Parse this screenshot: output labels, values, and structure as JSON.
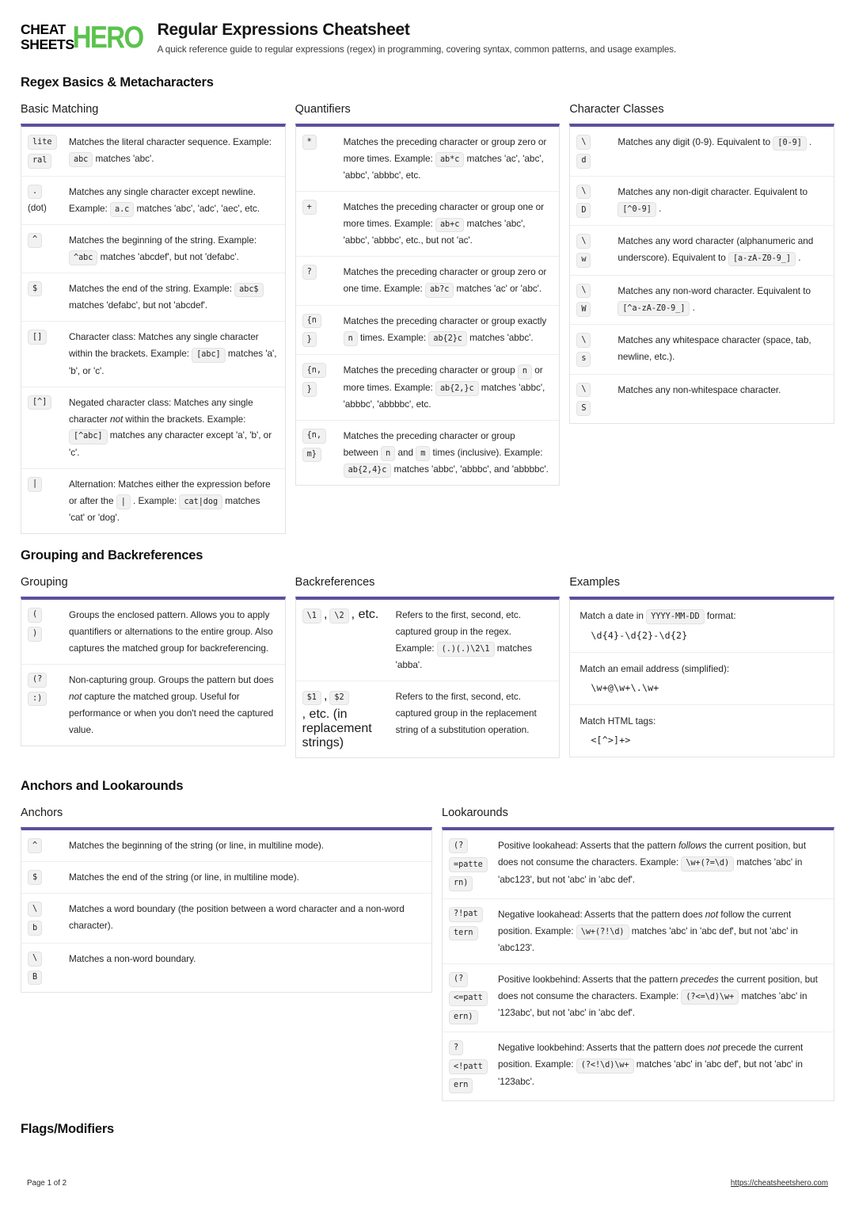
{
  "brand": {
    "line1": "CHEAT",
    "line2": "SHEETS",
    "hero": "HERO",
    "green": "#5cc24f"
  },
  "header": {
    "title": "Regular Expressions Cheatsheet",
    "subtitle": "A quick reference guide to regular expressions (regex) in programming, covering syntax, common patterns, and usage examples."
  },
  "accent": "#5d4f9e",
  "sections": [
    {
      "id": "basics",
      "title": "Regex Basics & Metacharacters"
    },
    {
      "id": "grouping",
      "title": "Grouping and Backreferences"
    },
    {
      "id": "anchors",
      "title": "Anchors and Lookarounds"
    },
    {
      "id": "flags",
      "title": "Flags/Modifiers"
    }
  ],
  "cards": {
    "basic_matching": {
      "title": "Basic Matching",
      "rows": [
        {
          "keys": [
            "lite",
            "ral"
          ],
          "desc": [
            {
              "t": "text",
              "v": "Matches the literal character sequence. Example: "
            },
            {
              "t": "chip",
              "v": "abc"
            },
            {
              "t": "text",
              "v": " matches 'abc'."
            }
          ]
        },
        {
          "keys": [
            "."
          ],
          "keys_plain": [
            "(dot)"
          ],
          "desc": [
            {
              "t": "text",
              "v": "Matches any single character except newline. Example: "
            },
            {
              "t": "chip",
              "v": "a.c"
            },
            {
              "t": "text",
              "v": " matches 'abc', 'adc', 'aec', etc."
            }
          ]
        },
        {
          "keys": [
            "^"
          ],
          "desc": [
            {
              "t": "text",
              "v": "Matches the beginning of the string. Example: "
            },
            {
              "t": "chip",
              "v": "^abc"
            },
            {
              "t": "text",
              "v": " matches 'abcdef', but not 'defabc'."
            }
          ]
        },
        {
          "keys": [
            "$"
          ],
          "desc": [
            {
              "t": "text",
              "v": "Matches the end of the string. Example: "
            },
            {
              "t": "chip",
              "v": "abc$"
            },
            {
              "t": "text",
              "v": " matches 'defabc', but not 'abcdef'."
            }
          ]
        },
        {
          "keys": [
            "[]"
          ],
          "desc": [
            {
              "t": "text",
              "v": "Character class: Matches any single character within the brackets. Example: "
            },
            {
              "t": "chip",
              "v": "[abc]"
            },
            {
              "t": "text",
              "v": " matches 'a', 'b', or 'c'."
            }
          ]
        },
        {
          "keys": [
            "[^]"
          ],
          "desc": [
            {
              "t": "text",
              "v": "Negated character class: Matches any single character "
            },
            {
              "t": "em",
              "v": "not"
            },
            {
              "t": "text",
              "v": " within the brackets. Example: "
            },
            {
              "t": "chip",
              "v": "[^abc]"
            },
            {
              "t": "text",
              "v": " matches any character except 'a', 'b', or 'c'."
            }
          ]
        },
        {
          "keys": [
            "|"
          ],
          "desc": [
            {
              "t": "text",
              "v": "Alternation: Matches either the expression before or after the "
            },
            {
              "t": "chip",
              "v": "|"
            },
            {
              "t": "text",
              "v": " . Example: "
            },
            {
              "t": "chip",
              "v": "cat|dog"
            },
            {
              "t": "text",
              "v": " matches 'cat' or 'dog'."
            }
          ]
        }
      ]
    },
    "quantifiers": {
      "title": "Quantifiers",
      "rows": [
        {
          "keys": [
            "*"
          ],
          "desc": [
            {
              "t": "text",
              "v": "Matches the preceding character or group zero or more times. Example: "
            },
            {
              "t": "chip",
              "v": "ab*c"
            },
            {
              "t": "text",
              "v": " matches 'ac', 'abc', 'abbc', 'abbbc', etc."
            }
          ]
        },
        {
          "keys": [
            "+"
          ],
          "desc": [
            {
              "t": "text",
              "v": "Matches the preceding character or group one or more times. Example: "
            },
            {
              "t": "chip",
              "v": "ab+c"
            },
            {
              "t": "text",
              "v": " matches 'abc', 'abbc', 'abbbc', etc., but not 'ac'."
            }
          ]
        },
        {
          "keys": [
            "?"
          ],
          "desc": [
            {
              "t": "text",
              "v": "Matches the preceding character or group zero or one time. Example: "
            },
            {
              "t": "chip",
              "v": "ab?c"
            },
            {
              "t": "text",
              "v": " matches 'ac' or 'abc'."
            }
          ]
        },
        {
          "keys": [
            "{n",
            "}"
          ],
          "desc": [
            {
              "t": "text",
              "v": "Matches the preceding character or group exactly "
            },
            {
              "t": "chip",
              "v": "n"
            },
            {
              "t": "text",
              "v": " times. Example: "
            },
            {
              "t": "chip",
              "v": "ab{2}c"
            },
            {
              "t": "text",
              "v": " matches 'abbc'."
            }
          ]
        },
        {
          "keys": [
            "{n,",
            "}"
          ],
          "desc": [
            {
              "t": "text",
              "v": "Matches the preceding character or group "
            },
            {
              "t": "chip",
              "v": "n"
            },
            {
              "t": "text",
              "v": " or more times. Example: "
            },
            {
              "t": "chip",
              "v": "ab{2,}c"
            },
            {
              "t": "text",
              "v": " matches 'abbc', 'abbbc', 'abbbbc', etc."
            }
          ]
        },
        {
          "keys": [
            "{n,",
            "m}"
          ],
          "desc": [
            {
              "t": "text",
              "v": "Matches the preceding character or group between "
            },
            {
              "t": "chip",
              "v": "n"
            },
            {
              "t": "text",
              "v": " and "
            },
            {
              "t": "chip",
              "v": "m"
            },
            {
              "t": "text",
              "v": " times (inclusive). Example: "
            },
            {
              "t": "chip",
              "v": "ab{2,4}c"
            },
            {
              "t": "text",
              "v": " matches 'abbc', 'abbbc', and 'abbbbc'."
            }
          ]
        }
      ]
    },
    "character_classes": {
      "title": "Character Classes",
      "rows": [
        {
          "keys": [
            "\\",
            "d"
          ],
          "desc": [
            {
              "t": "text",
              "v": "Matches any digit (0-9). Equivalent to "
            },
            {
              "t": "chip",
              "v": "[0-9]"
            },
            {
              "t": "text",
              "v": " ."
            }
          ]
        },
        {
          "keys": [
            "\\",
            "D"
          ],
          "desc": [
            {
              "t": "text",
              "v": "Matches any non-digit character. Equivalent to "
            },
            {
              "t": "chip",
              "v": "[^0-9]"
            },
            {
              "t": "text",
              "v": " ."
            }
          ]
        },
        {
          "keys": [
            "\\",
            "w"
          ],
          "desc": [
            {
              "t": "text",
              "v": "Matches any word character (alphanumeric and underscore). Equivalent to "
            },
            {
              "t": "chip",
              "v": "[a-zA-Z0-9_]"
            },
            {
              "t": "text",
              "v": " ."
            }
          ]
        },
        {
          "keys": [
            "\\",
            "W"
          ],
          "desc": [
            {
              "t": "text",
              "v": "Matches any non-word character. Equivalent to "
            },
            {
              "t": "chip",
              "v": "[^a-zA-Z0-9_]"
            },
            {
              "t": "text",
              "v": " ."
            }
          ]
        },
        {
          "keys": [
            "\\",
            "s"
          ],
          "desc": [
            {
              "t": "text",
              "v": "Matches any whitespace character (space, tab, newline, etc.)."
            }
          ]
        },
        {
          "keys": [
            "\\",
            "S"
          ],
          "desc": [
            {
              "t": "text",
              "v": "Matches any non-whitespace character."
            }
          ]
        }
      ]
    },
    "grouping": {
      "title": "Grouping",
      "rows": [
        {
          "keys": [
            "(",
            ")"
          ],
          "desc": [
            {
              "t": "text",
              "v": "Groups the enclosed pattern. Allows you to apply quantifiers or alternations to the entire group. Also captures the matched group for backreferencing."
            }
          ]
        },
        {
          "keys": [
            "(?",
            ":)"
          ],
          "desc": [
            {
              "t": "text",
              "v": "Non-capturing group. Groups the pattern but does "
            },
            {
              "t": "em",
              "v": "not"
            },
            {
              "t": "text",
              "v": " capture the matched group. Useful for performance or when you don't need the captured value."
            }
          ]
        }
      ]
    },
    "backreferences": {
      "title": "Backreferences",
      "rows": [
        {
          "keys_inline": [
            {
              "t": "chip",
              "v": "\\1"
            },
            {
              "t": "text",
              "v": ", "
            },
            {
              "t": "chip",
              "v": "\\2"
            },
            {
              "t": "text",
              "v": ", etc."
            }
          ],
          "desc": [
            {
              "t": "text",
              "v": "Refers to the first, second, etc. captured group in the regex. Example: "
            },
            {
              "t": "chip",
              "v": "(.)(.)\\2\\1"
            },
            {
              "t": "text",
              "v": " matches 'abba'."
            }
          ]
        },
        {
          "keys_inline": [
            {
              "t": "chip",
              "v": "$1"
            },
            {
              "t": "text",
              "v": ", "
            },
            {
              "t": "chip",
              "v": "$2"
            },
            {
              "t": "text",
              "v": ", etc. (in replacement strings)"
            }
          ],
          "desc": [
            {
              "t": "text",
              "v": "Refers to the first, second, etc. captured group in the replacement string of a substitution operation."
            }
          ]
        }
      ]
    },
    "examples": {
      "title": "Examples",
      "rows": [
        {
          "lead": [
            {
              "t": "text",
              "v": "Match a date in "
            },
            {
              "t": "chip",
              "v": "YYYY-MM-DD"
            },
            {
              "t": "text",
              "v": " format:"
            }
          ],
          "code": "\\d{4}-\\d{2}-\\d{2}"
        },
        {
          "lead": [
            {
              "t": "text",
              "v": "Match an email address (simplified):"
            }
          ],
          "code": "\\w+@\\w+\\.\\w+"
        },
        {
          "lead": [
            {
              "t": "text",
              "v": "Match HTML tags:"
            }
          ],
          "code": "<[^>]+>"
        }
      ]
    },
    "anchors": {
      "title": "Anchors",
      "rows": [
        {
          "keys": [
            "^"
          ],
          "desc": [
            {
              "t": "text",
              "v": "Matches the beginning of the string (or line, in multiline mode)."
            }
          ]
        },
        {
          "keys": [
            "$"
          ],
          "desc": [
            {
              "t": "text",
              "v": "Matches the end of the string (or line, in multiline mode)."
            }
          ]
        },
        {
          "keys": [
            "\\",
            "b"
          ],
          "desc": [
            {
              "t": "text",
              "v": "Matches a word boundary (the position between a word character and a non-word character)."
            }
          ]
        },
        {
          "keys": [
            "\\",
            "B"
          ],
          "desc": [
            {
              "t": "text",
              "v": "Matches a non-word boundary."
            }
          ]
        }
      ]
    },
    "lookarounds": {
      "title": "Lookarounds",
      "rows": [
        {
          "keys": [
            "(?",
            "=patte",
            "rn)"
          ],
          "desc": [
            {
              "t": "text",
              "v": "Positive lookahead: Asserts that the pattern "
            },
            {
              "t": "em",
              "v": "follows"
            },
            {
              "t": "text",
              "v": " the current position, but does not consume the characters. Example: "
            },
            {
              "t": "chip",
              "v": "\\w+(?=\\d)"
            },
            {
              "t": "text",
              "v": " matches 'abc' in 'abc123', but not 'abc' in 'abc def'."
            }
          ]
        },
        {
          "keys": [
            "?!pat",
            "tern"
          ],
          "desc": [
            {
              "t": "text",
              "v": "Negative lookahead: Asserts that the pattern does "
            },
            {
              "t": "em",
              "v": "not"
            },
            {
              "t": "text",
              "v": " follow the current position. Example: "
            },
            {
              "t": "chip",
              "v": "\\w+(?!\\d)"
            },
            {
              "t": "text",
              "v": " matches 'abc' in 'abc def', but not 'abc' in 'abc123'."
            }
          ]
        },
        {
          "keys": [
            "(?",
            "<=patt",
            "ern)"
          ],
          "desc": [
            {
              "t": "text",
              "v": "Positive lookbehind: Asserts that the pattern "
            },
            {
              "t": "em",
              "v": "precedes"
            },
            {
              "t": "text",
              "v": " the current position, but does not consume the characters. Example: "
            },
            {
              "t": "chip",
              "v": "(?<=\\d)\\w+"
            },
            {
              "t": "text",
              "v": " matches 'abc' in '123abc', but not 'abc' in 'abc def'."
            }
          ]
        },
        {
          "keys": [
            "?",
            "<!patt",
            "ern"
          ],
          "desc": [
            {
              "t": "text",
              "v": "Negative lookbehind: Asserts that the pattern does "
            },
            {
              "t": "em",
              "v": "not"
            },
            {
              "t": "text",
              "v": " precede the current position. Example: "
            },
            {
              "t": "chip",
              "v": "(?<!\\d)\\w+"
            },
            {
              "t": "text",
              "v": " matches 'abc' in 'abc def', but not 'abc' in '123abc'."
            }
          ]
        }
      ]
    }
  },
  "footer": {
    "page": "Page 1 of 2",
    "url": "https://cheatsheetshero.com"
  }
}
